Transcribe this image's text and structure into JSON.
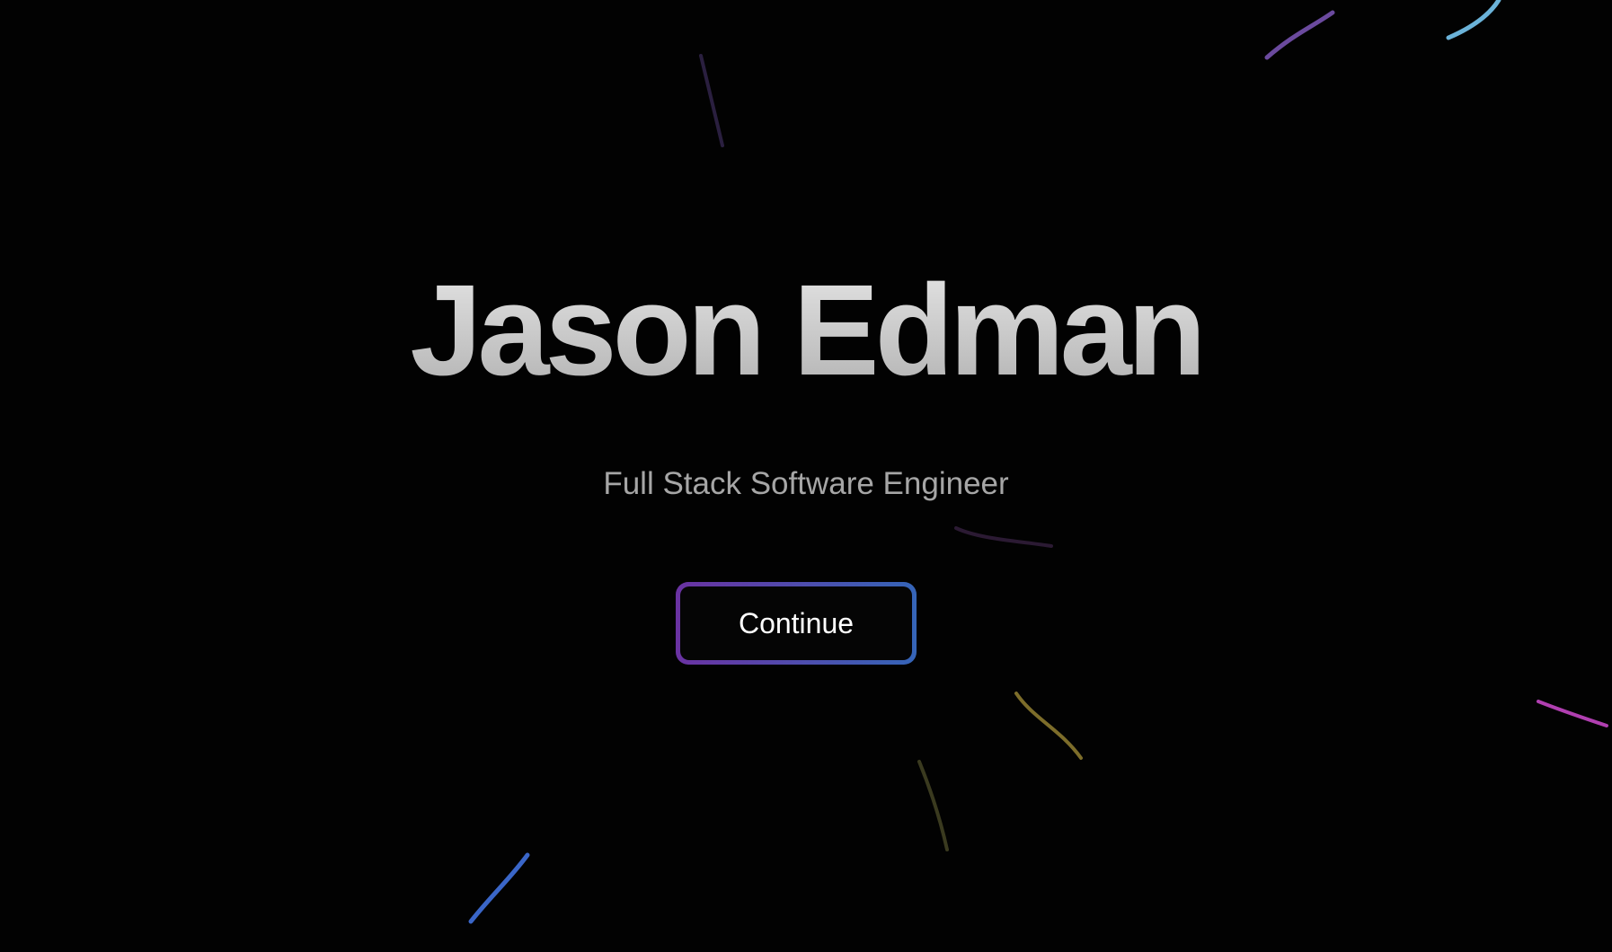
{
  "hero": {
    "title": "Jason Edman",
    "subtitle": "Full Stack Software Engineer",
    "continue_label": "Continue"
  },
  "colors": {
    "background": "#020202",
    "title_gradient": [
      "#e6e6e6",
      "#b0b0b0"
    ],
    "subtitle": "#a6a6a6",
    "button_border_gradient": [
      "#6a32a2",
      "#3565b8"
    ],
    "button_text": "#ffffff"
  },
  "streak_colors": [
    "#2a1f3f",
    "#6b4a9e",
    "#6bb3d9",
    "#2b1a33",
    "#7d6d2a",
    "#3a3a1f",
    "#b03fb0",
    "#3a66c8"
  ]
}
